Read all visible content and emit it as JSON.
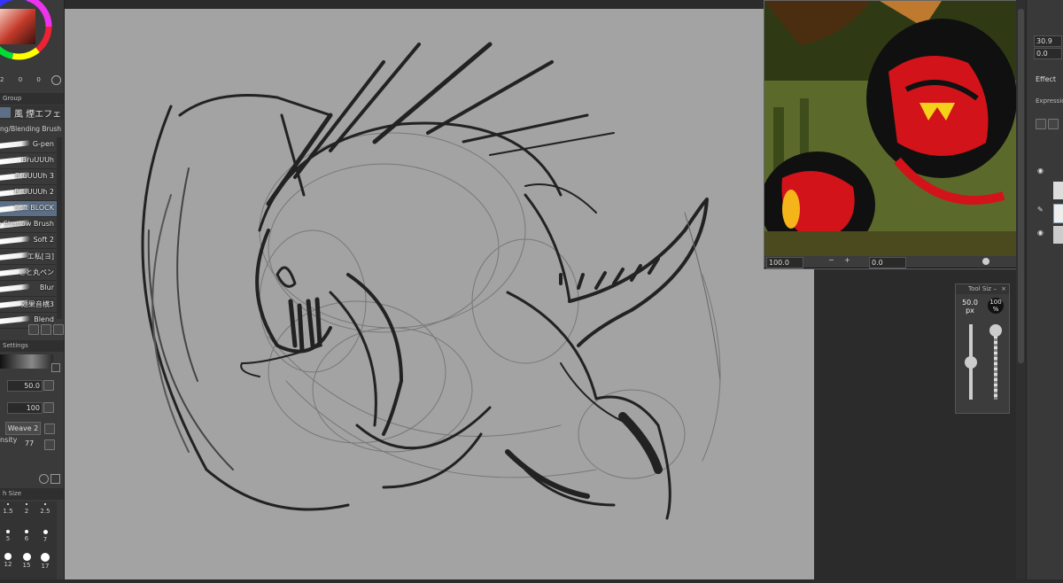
{
  "brush_panel": {
    "color_values": [
      "2",
      "0",
      "0"
    ],
    "group_label": "Group",
    "tabs": [
      "風 煙エフェ"
    ],
    "category_label": "ng/Blending Brush",
    "brushes": [
      {
        "name": "G-pen",
        "selected": false
      },
      {
        "name": "BruUUUh",
        "selected": false
      },
      {
        "name": "BruUUUh 3",
        "selected": false
      },
      {
        "name": "BrUUUUh 2",
        "selected": false
      },
      {
        "name": "Soft BLOCK",
        "selected": true
      },
      {
        "name": "se Shadow Brush",
        "selected": false
      },
      {
        "name": "Soft 2",
        "selected": false
      },
      {
        "name": "エ私[ヨ]",
        "selected": false
      },
      {
        "name": "とと丸ペン",
        "selected": false
      },
      {
        "name": "Blur",
        "selected": false
      },
      {
        "name": "効果音横3",
        "selected": false
      },
      {
        "name": "Blend",
        "selected": false
      }
    ],
    "settings_label": "Settings",
    "size_value": "50.0",
    "opacity_value": "100",
    "texture_name": "Weave 2",
    "density_label": "nsity",
    "density_value": "77",
    "brush_size_label": "h Size",
    "size_presets_row1": [
      "1.5",
      "2",
      "2.5"
    ],
    "size_presets_row2": [
      "5",
      "6",
      "7"
    ],
    "size_presets_row3": [
      "12",
      "15",
      "17"
    ]
  },
  "navigator": {
    "zoom_value": "100.0",
    "rotation_value": "0.0"
  },
  "tool_size_panel": {
    "title": "Tool Siz",
    "size_value": "50.0",
    "size_unit": "px",
    "opacity_value": "100",
    "opacity_unit": "%",
    "size_level": 0.5,
    "opacity_level": 1.0
  },
  "right_panel": {
    "value_1": "30.9",
    "value_2": "0.0",
    "effect_label": "Effect",
    "expression_label": "Expression"
  },
  "colors": {
    "canvas_bg": "#a3a3a3",
    "panel_bg": "#3a3a3a",
    "selected_brush": "#5c6f86"
  }
}
